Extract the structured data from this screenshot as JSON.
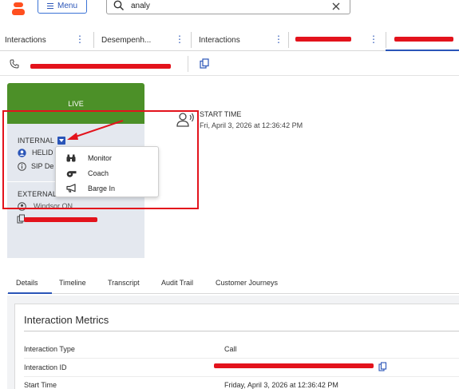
{
  "topbar": {
    "menu_label": "Menu",
    "search_value": "analy"
  },
  "tabs": [
    {
      "label": "Interactions"
    },
    {
      "label": "Desempenh..."
    },
    {
      "label": "Interactions"
    }
  ],
  "participant": {
    "status": "LIVE",
    "internal_label": "INTERNAL",
    "internal_name": "HELID",
    "internal_sub": "SIP De",
    "external_label": "EXTERNAL",
    "external_name": "Windsor ON"
  },
  "dropdown": {
    "items": [
      {
        "label": "Monitor",
        "icon": "binoculars-icon"
      },
      {
        "label": "Coach",
        "icon": "whistle-icon"
      },
      {
        "label": "Barge In",
        "icon": "megaphone-icon"
      }
    ]
  },
  "start": {
    "label": "START TIME",
    "value": "Fri, April 3, 2026 at 12:36:42 PM"
  },
  "detail_tabs": [
    "Details",
    "Timeline",
    "Transcript",
    "Audit Trail",
    "Customer Journeys"
  ],
  "metrics": {
    "title": "Interaction Metrics",
    "rows": [
      {
        "label": "Interaction Type",
        "value": "Call"
      },
      {
        "label": "Interaction ID",
        "value": ""
      },
      {
        "label": "Start Time",
        "value": "Friday, April 3, 2026 at 12:36:42 PM"
      }
    ]
  },
  "colors": {
    "accent": "#2a55b8",
    "live_green": "#4c9028",
    "annotation_red": "#e3131c",
    "brand_orange": "#ff4f1f"
  }
}
